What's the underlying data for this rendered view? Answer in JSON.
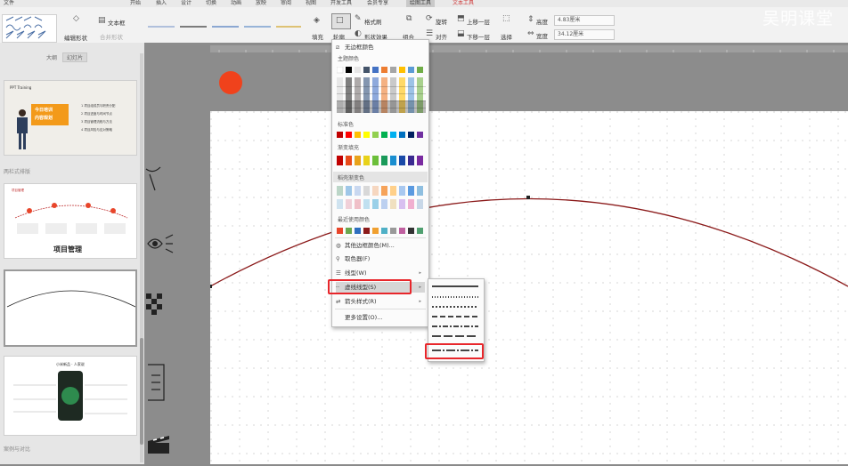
{
  "menubar": {
    "items": [
      "文件",
      "开始",
      "插入",
      "设计",
      "切换",
      "动画",
      "放映",
      "审阅",
      "视图",
      "开发工具",
      "会员专享",
      "绘图工具",
      "文本工具"
    ]
  },
  "toolbar": {
    "edit_shape_label": "编辑形状",
    "textbox_label": "文本框",
    "merge_shapes_label": "合并形状",
    "fill_label": "填充",
    "outline_label": "轮廓",
    "format_painter_label": "格式刷",
    "shape_effects_label": "形状效果",
    "group_label": "组合",
    "rotate_label": "旋转",
    "align_label": "对齐",
    "bring_forward_label": "上移一层",
    "send_backward_label": "下移一层",
    "select_label": "选择",
    "height_label": "高度",
    "height_value": "4.83厘米",
    "width_label": "宽度",
    "width_value": "34.12厘米"
  },
  "watermark": "吴明课堂",
  "left_panel": {
    "tab_outline": "大纲",
    "tab_slides": "幻灯片",
    "section_1": "两栏式排版",
    "section_2": "案例与对比",
    "thumb1": {
      "header": "PPT Training",
      "banner_line1": "今日培训",
      "banner_line2": "内容规划",
      "items": [
        "1 项目组成员与职责分配",
        "2 项目进度与时间节点",
        "3 项目管理流程与方法",
        "4 项目风险与应对策略"
      ]
    },
    "thumb2": {
      "header": "项目管理",
      "title": "项目管理"
    },
    "thumb4": {
      "title": "小米新品 · 人家说"
    }
  },
  "dropdown": {
    "no_outline": "无边框颜色",
    "theme_colors": "主题颜色",
    "standard_colors": "标准色",
    "gradient_fill": "渐变填充",
    "recommended_gradient": "稻壳渐变色",
    "recent_colors": "最近使用颜色",
    "more_colors": "其他边框颜色(M)...",
    "eyedropper": "取色器(F)",
    "line_weight": "线型(W)",
    "dash_type": "虚线线型(S)",
    "arrow_style": "箭头样式(R)",
    "more_settings": "更多设置(O)..."
  },
  "colors": {
    "accent_red": "#e8262b",
    "curve": "#8b1a1a",
    "dot": "#f0421c"
  }
}
